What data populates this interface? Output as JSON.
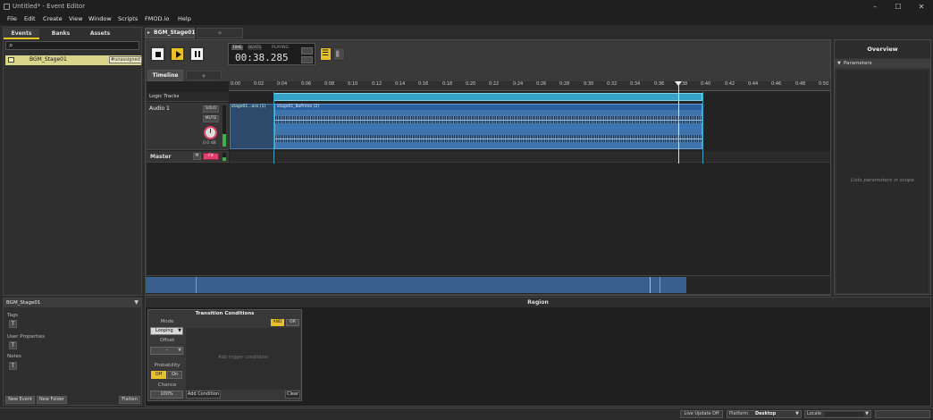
{
  "window": {
    "title": "Untitled* - Event Editor",
    "controls": {
      "minimize": "–",
      "maximize": "☐",
      "close": "✕"
    }
  },
  "menu": [
    "File",
    "Edit",
    "Create",
    "View",
    "Window",
    "Scripts",
    "FMOD.io",
    "Help"
  ],
  "browser": {
    "tabs": [
      "Events",
      "Banks",
      "Assets"
    ],
    "active_tab": "Events",
    "search_placeholder": "",
    "events": [
      {
        "name": "BGM_Stage01",
        "tag": "#unassigned"
      }
    ]
  },
  "event_tab": {
    "label": "BGM_Stage01",
    "new_tab": "+"
  },
  "transport": {
    "time_label": "TIME",
    "beats_label": "BEATS",
    "playing_label": "PLAYING",
    "time_display": "00:38.285"
  },
  "timeline": {
    "tabs": [
      "Timeline",
      "+"
    ],
    "ruler": [
      "0:00",
      "0:02",
      "0:04",
      "0:06",
      "0:08",
      "0:10",
      "0:12",
      "0:14",
      "0:16",
      "0:18",
      "0:20",
      "0:22",
      "0:24",
      "0:26",
      "0:28",
      "0:30",
      "0:32",
      "0:34",
      "0:36",
      "0:38",
      "0:40",
      "0:42",
      "0:44",
      "0:46",
      "0:48",
      "0:50"
    ],
    "logic_tracks_label": "Logic Tracks",
    "audio_track": {
      "name": "Audio 1",
      "solo": "SOLO",
      "mute": "MUTE",
      "volume": "0.0 dB",
      "instruments": [
        "stage01...ons (1)",
        "stage01_BoPrime (2)"
      ]
    },
    "master_track": {
      "name": "Master",
      "m": "M",
      "fx": "FX"
    }
  },
  "overview": {
    "title": "Overview",
    "parameters_label": "Parameters",
    "placeholder": "Lists parameters in scope"
  },
  "details": {
    "title": "BGM_Stage01",
    "sections": [
      "Tags",
      "User Properties",
      "Notes"
    ],
    "buttons": [
      "New Event",
      "New Folder",
      "Flatten"
    ]
  },
  "region": {
    "title": "Region",
    "transition": {
      "title": "Transition Conditions",
      "mode_label": "Mode",
      "mode_value": "Looping",
      "offset_label": "Offset",
      "offset_value": "--",
      "probability_label": "Probability",
      "off": "Off",
      "on": "On",
      "chance_label": "Chance",
      "chance_value": "100%",
      "and": "AND",
      "or": "OR",
      "placeholder": "Add trigger conditions",
      "add_condition": "Add Condition",
      "clear": "Clear"
    }
  },
  "statusbar": {
    "live_update": "Live Update Off",
    "platform_label": "Platform",
    "platform_value": "Desktop",
    "locale_label": "Locale"
  },
  "colors": {
    "accent": "#e6c228",
    "clip_blue": "#3f74ad",
    "logic_cyan": "#35a3c8",
    "pink": "#e0406a"
  }
}
